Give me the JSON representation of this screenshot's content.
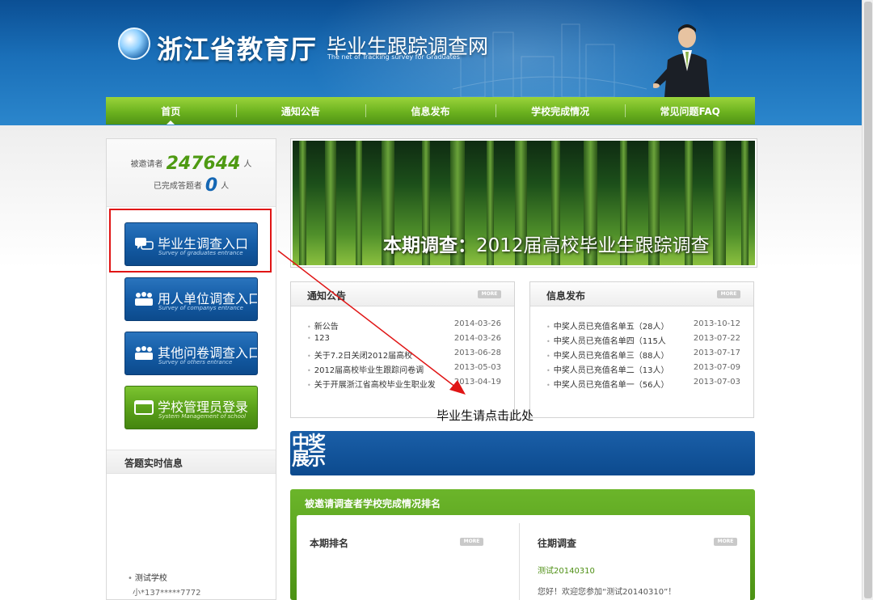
{
  "header": {
    "title": "浙江省教育厅",
    "subtitle": "毕业生跟踪调查网",
    "subtitle_en": "The net of Tracking survey for Graduates"
  },
  "nav": [
    {
      "label": "首页",
      "active": true
    },
    {
      "label": "通知公告"
    },
    {
      "label": "信息发布"
    },
    {
      "label": "学校完成情况"
    },
    {
      "label": "常见问题FAQ"
    }
  ],
  "stats": {
    "invited_label": "被邀请者",
    "invited_count": "247644",
    "unit": "人",
    "done_label": "已完成答题者",
    "done_count": "0"
  },
  "entries": [
    {
      "title": "毕业生调查入口",
      "sub": "Survey of graduates entrance",
      "icon": "chat-bubbles-icon"
    },
    {
      "title": "用人单位调查入口",
      "sub": "Survey of companys entrance",
      "icon": "people-group-icon"
    },
    {
      "title": "其他问卷调查入口",
      "sub": "Survey of others entrance",
      "icon": "people-group-icon"
    },
    {
      "title": "学校管理员登录",
      "sub": "System Management of school",
      "icon": "window-icon"
    }
  ],
  "live": {
    "title": "答题实时信息",
    "item_school": "测试学校",
    "item_user": "小*137*****7772"
  },
  "banner": {
    "prefix": "本期调查：",
    "text": "2012届高校毕业生跟踪调查"
  },
  "notice": {
    "title": "通知公告",
    "more": "MORE",
    "items": [
      {
        "text": "新公告",
        "date": "2014-03-26"
      },
      {
        "text": "123",
        "date": "2014-03-26"
      },
      {
        "text": "关于7.2日关闭2012届高校",
        "date": "2013-06-28"
      },
      {
        "text": "2012届高校毕业生跟踪问卷调",
        "date": "2013-05-03"
      },
      {
        "text": "关于开展浙江省高校毕业生职业发",
        "date": "2013-04-19"
      }
    ]
  },
  "info": {
    "title": "信息发布",
    "more": "MORE",
    "items": [
      {
        "text": "中奖人员已充值名单五（28人）",
        "date": "2013-10-12"
      },
      {
        "text": "中奖人员已充值名单四（115人",
        "date": "2013-07-22"
      },
      {
        "text": "中奖人员已充值名单三（88人）",
        "date": "2013-07-17"
      },
      {
        "text": "中奖人员已充值名单二（13人）",
        "date": "2013-07-09"
      },
      {
        "text": "中奖人员已充值名单一（56人）",
        "date": "2013-07-03"
      }
    ]
  },
  "annotation": "毕业生请点击此处",
  "winners": {
    "title": "中奖展示"
  },
  "ranking": {
    "title": "被邀请调查者学校完成情况排名",
    "current": "本期排名",
    "past": "往期调查",
    "more": "MORE",
    "past_link": "测试20140310",
    "past_desc": "您好！欢迎您参加“测试20140310”！"
  },
  "colors": {
    "header_blue": "#1a6fb8",
    "nav_green": "#6cb21f",
    "stat_green": "#4e9a12",
    "stat_blue": "#1567b4",
    "highlight_red": "#e01515"
  }
}
